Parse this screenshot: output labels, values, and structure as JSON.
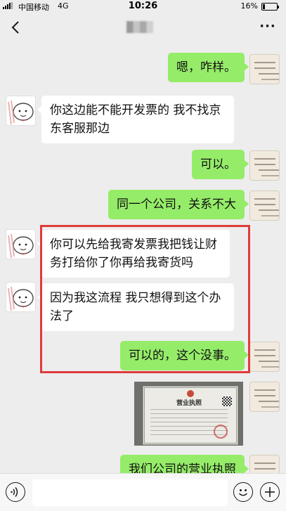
{
  "status_bar": {
    "carrier": "中国移动",
    "network": "4G",
    "time": "10:26",
    "battery_text": "16%",
    "battery_level": 0.16
  },
  "nav": {
    "back_icon": "chevron-left-icon",
    "more_icon": "more-dots-icon",
    "more_label": "···"
  },
  "messages": [
    {
      "side": "out",
      "text": "嗯，咋样。"
    },
    {
      "side": "in",
      "lines": [
        "你这边能不能开发票的 我不找京",
        "东客服那边"
      ]
    },
    {
      "side": "out",
      "text": "可以。"
    },
    {
      "side": "out",
      "text": "同一个公司，关系不大"
    },
    {
      "side": "in",
      "lines": [
        "你可以先给我寄发票我把钱让财",
        "务打给你了你再给我寄货吗"
      ]
    },
    {
      "side": "in",
      "lines": [
        "因为我这流程 我只想得到这个办",
        "法了"
      ]
    },
    {
      "side": "out",
      "text": "可以的，这个没事。"
    },
    {
      "side": "out",
      "type": "image",
      "image_title": "营业执照"
    },
    {
      "side": "out",
      "text": "我们公司的营业执照"
    }
  ],
  "input_bar": {
    "voice_icon": "voice-icon",
    "emoji_icon": "emoji-icon",
    "plus_icon": "plus-icon",
    "input_value": ""
  },
  "colors": {
    "background": "#ededed",
    "outgoing_bubble": "#95ec69",
    "incoming_bubble": "#ffffff",
    "highlight_border": "#e03b3b"
  }
}
